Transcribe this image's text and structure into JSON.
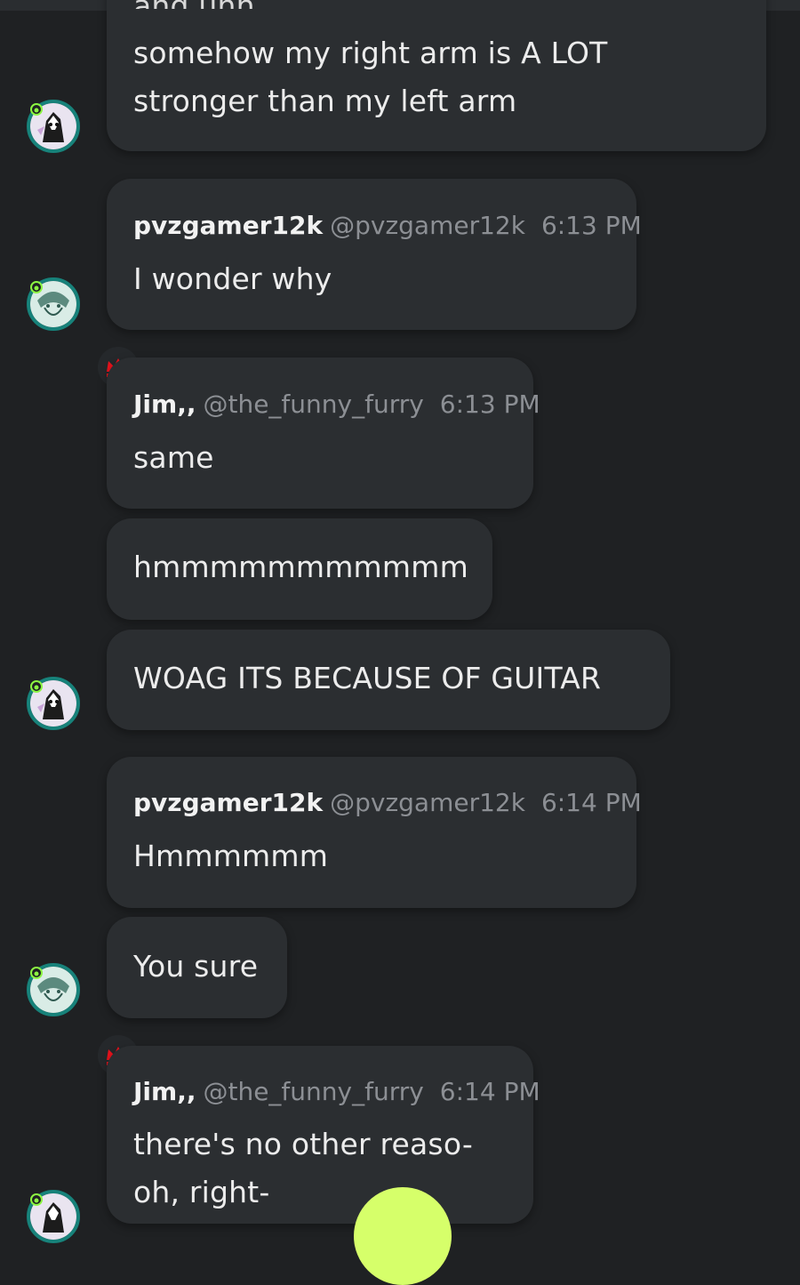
{
  "chat": {
    "m1": {
      "partial_line": "and uhh",
      "line1": "somehow my right arm is A LOT",
      "line2": "stronger than my left arm"
    },
    "m2": {
      "user": "pvzgamer12k",
      "handle": "@pvzgamer12k",
      "time": "6:13 PM",
      "text": "I wonder why"
    },
    "m3": {
      "user": "Jim,,",
      "handle": "@the_funny_furry",
      "time": "6:13 PM",
      "text": "same"
    },
    "m4": {
      "text": "hmmmmmmmmmmm"
    },
    "m5": {
      "text": "WOAG ITS BECAUSE OF GUITAR"
    },
    "m6": {
      "user": "pvzgamer12k",
      "handle": "@pvzgamer12k",
      "time": "6:14 PM",
      "text": "Hmmmmmm"
    },
    "m7": {
      "text": "You sure"
    },
    "m8": {
      "user": "Jim,,",
      "handle": "@the_funny_furry",
      "time": "6:14 PM",
      "line1": "there's no other reaso-",
      "line2": "oh, right-"
    }
  },
  "icons": {
    "crown": "crown-icon",
    "badge": "status-badge-icon",
    "avatar_a": "avatar-bw-character",
    "avatar_b": "avatar-green-sketch"
  },
  "colors": {
    "background": "#1f2123",
    "bubble": "#2b2e31",
    "avatar_ring": "#17827a",
    "badge": "#8cf542",
    "crown": "#e8121c",
    "fab": "#d6ff6a"
  }
}
